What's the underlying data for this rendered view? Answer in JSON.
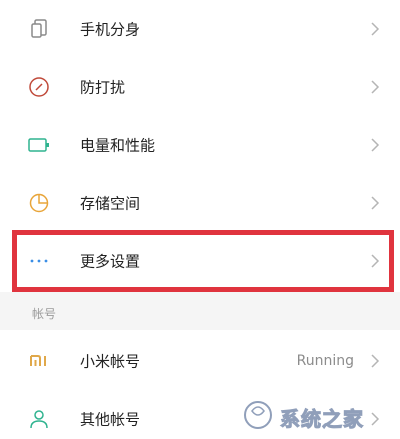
{
  "settings": {
    "items": [
      {
        "label": "手机分身",
        "icon": "clone-icon"
      },
      {
        "label": "防打扰",
        "icon": "do-not-disturb-icon"
      },
      {
        "label": "电量和性能",
        "icon": "battery-icon"
      },
      {
        "label": "存储空间",
        "icon": "storage-pie-icon"
      },
      {
        "label": "更多设置",
        "icon": "more-dots-icon"
      }
    ]
  },
  "accounts": {
    "header": "帐号",
    "items": [
      {
        "label": "小米帐号",
        "value": "Running",
        "icon": "mi-logo-icon"
      },
      {
        "label": "其他帐号",
        "icon": "person-icon"
      }
    ]
  },
  "watermark": {
    "text": "系统之家"
  },
  "colors": {
    "highlight": "#e0343e",
    "clone_icon": "#8a8a8a",
    "dnd_icon": "#c04a3a",
    "battery_icon": "#2fb38f",
    "storage_icon": "#e8a53a",
    "more_icon": "#3a8ee6",
    "mi_icon": "#e0a84a",
    "person_icon": "#2fb38f"
  }
}
